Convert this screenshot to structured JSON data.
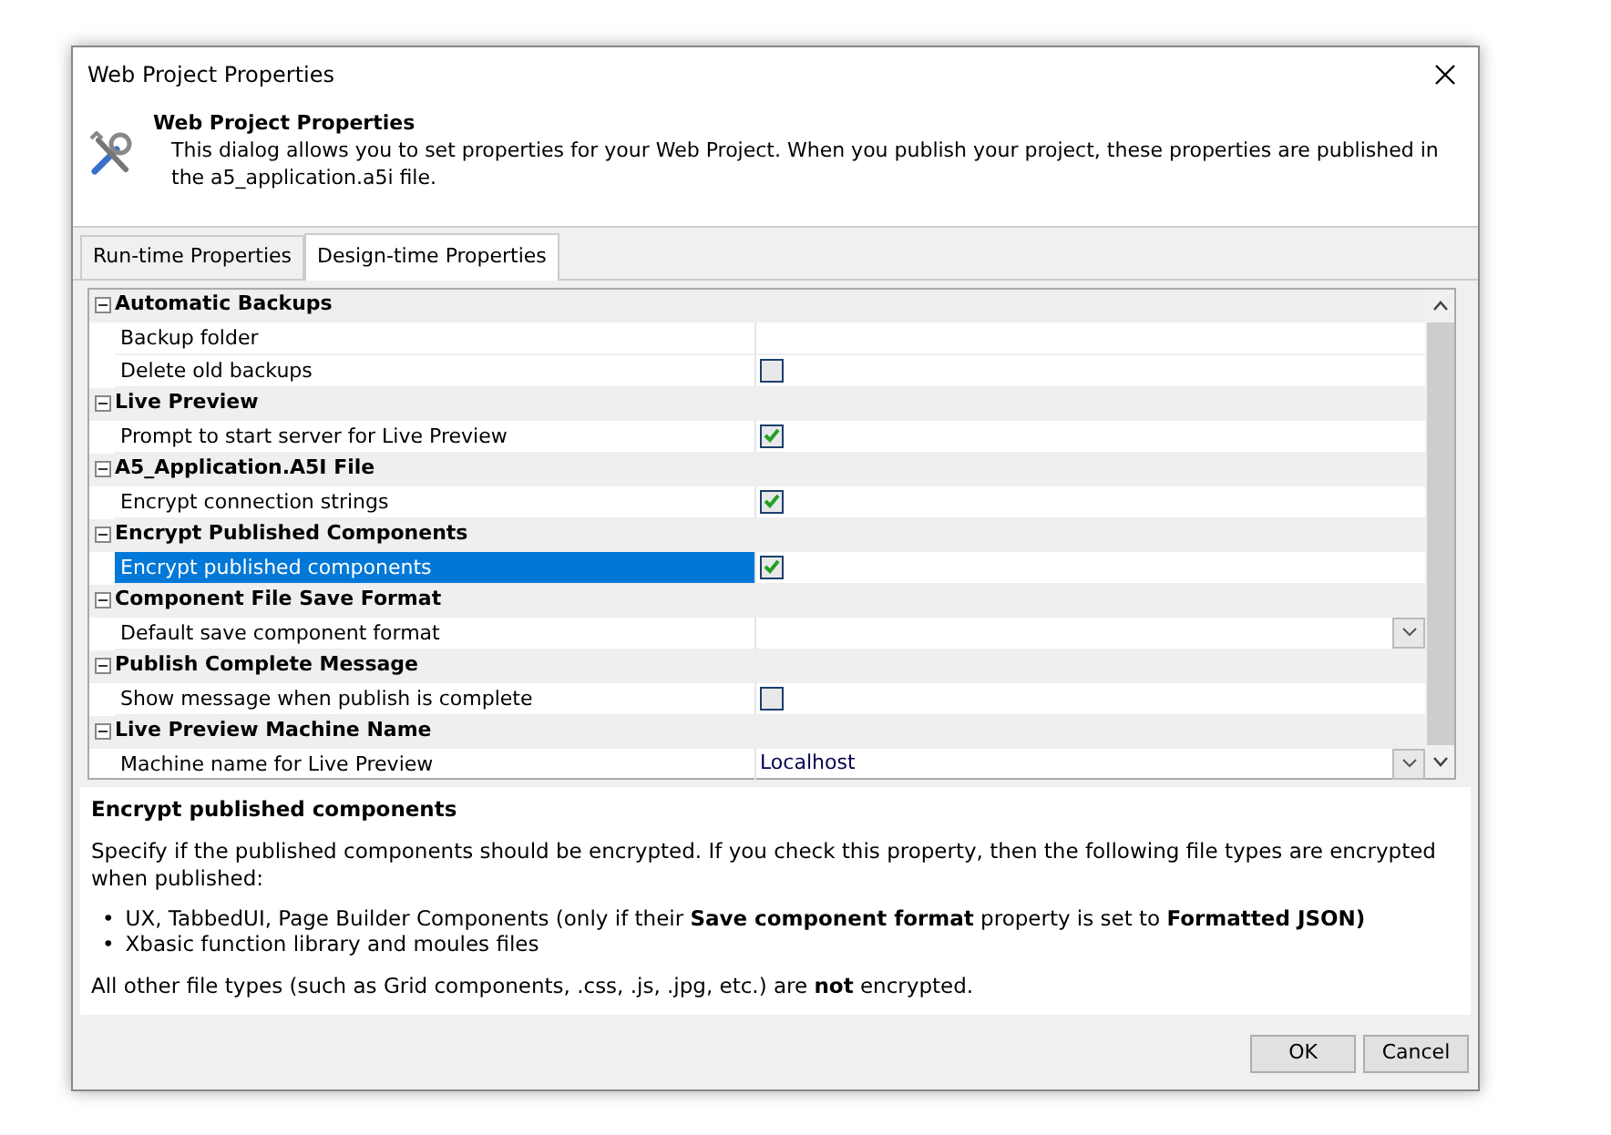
{
  "window": {
    "title": "Web Project Properties"
  },
  "header": {
    "title": "Web Project Properties",
    "description": "This dialog allows you to set properties for your Web Project. When you publish your project, these properties are published in the a5_application.a5i file."
  },
  "tabs": [
    {
      "label": "Run-time Properties",
      "selected": false
    },
    {
      "label": "Design-time Properties",
      "selected": true
    }
  ],
  "categories": [
    {
      "name": "Automatic Backups",
      "expanded": true,
      "properties": [
        {
          "name": "Backup folder",
          "kind": "text",
          "selected": false
        },
        {
          "name": "Delete old backups",
          "kind": "checkbox",
          "checked": false,
          "selected": false
        }
      ]
    },
    {
      "name": "Live Preview",
      "expanded": true,
      "properties": [
        {
          "name": "Prompt to start server for Live Preview",
          "kind": "checkbox",
          "checked": true,
          "selected": false
        }
      ]
    },
    {
      "name": "A5_Application.A5I File",
      "expanded": true,
      "properties": [
        {
          "name": "Encrypt connection strings",
          "kind": "checkbox",
          "checked": true,
          "selected": false
        }
      ]
    },
    {
      "name": "Encrypt Published Components",
      "expanded": true,
      "properties": [
        {
          "name": "Encrypt published components",
          "kind": "checkbox",
          "checked": true,
          "selected": true
        }
      ]
    },
    {
      "name": "Component File Save Format",
      "expanded": true,
      "properties": [
        {
          "name": "Default save component format",
          "kind": "dropdown",
          "selected": false
        }
      ]
    },
    {
      "name": "Publish Complete Message",
      "expanded": true,
      "properties": [
        {
          "name": "Show message when publish is complete",
          "kind": "checkbox",
          "checked": false,
          "selected": false
        }
      ]
    },
    {
      "name": "Live Preview Machine Name",
      "expanded": true,
      "properties": [
        {
          "name": "Machine name for Live Preview",
          "kind": "dropdown",
          "value": "Localhost",
          "selected": false
        }
      ]
    }
  ],
  "help": {
    "title": "Encrypt published components",
    "intro": "Specify if the published components should be encrypted. If you check this property, then the following file types are encrypted when published:",
    "bullets": [
      {
        "marker": "•",
        "text": "UX, TabbedUI, Page Builder Components (only if their **Save component format** property is set to **Formatted JSON)**"
      },
      {
        "marker": "•",
        "text": "Xbasic function library and moules files"
      }
    ],
    "footer": "All other file types (such as Grid components, .css, .js, .jpg, etc.) are **not** encrypted."
  },
  "buttons": [
    {
      "label": "OK"
    },
    {
      "label": "Cancel"
    }
  ]
}
